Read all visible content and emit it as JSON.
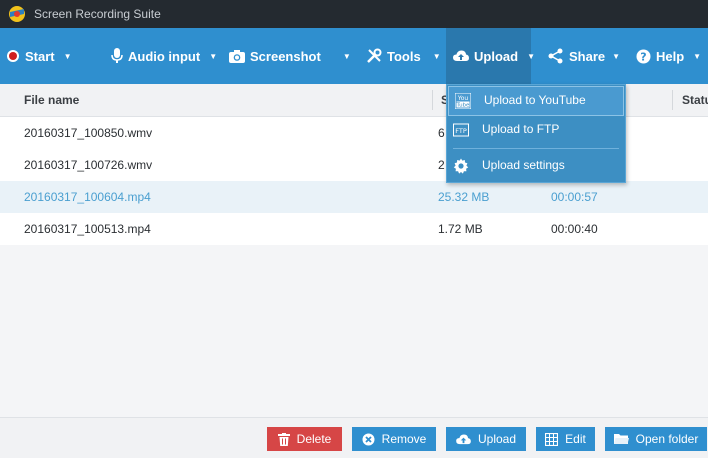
{
  "window": {
    "title": "Screen Recording Suite"
  },
  "toolbar": {
    "start": "Start",
    "audio_input": "Audio input",
    "screenshot": "Screenshot",
    "tools": "Tools",
    "upload": "Upload",
    "share": "Share",
    "help": "Help"
  },
  "table": {
    "columns": {
      "name": "File name",
      "size": "S",
      "status": "Statu"
    },
    "rows": [
      {
        "name": "20160317_100850.wmv",
        "size": "6",
        "duration": ""
      },
      {
        "name": "20160317_100726.wmv",
        "size": "2",
        "duration": ""
      },
      {
        "name": "20160317_100604.mp4",
        "size": "25.32 MB",
        "duration": "00:00:57"
      },
      {
        "name": "20160317_100513.mp4",
        "size": "1.72 MB",
        "duration": "00:00:40"
      }
    ]
  },
  "upload_menu": {
    "youtube": "Upload to YouTube",
    "ftp": "Upload to FTP",
    "settings": "Upload settings",
    "youtube_icon_top": "You",
    "youtube_icon_bottom": "Tube",
    "ftp_icon": "FTP"
  },
  "actions": {
    "delete": "Delete",
    "remove": "Remove",
    "upload": "Upload",
    "edit": "Edit",
    "open_folder": "Open folder"
  },
  "colors": {
    "toolbar": "#2f8fcf",
    "titlebar": "#242a30",
    "delete_button": "#d64646",
    "selected_text": "#4a9fd0"
  }
}
